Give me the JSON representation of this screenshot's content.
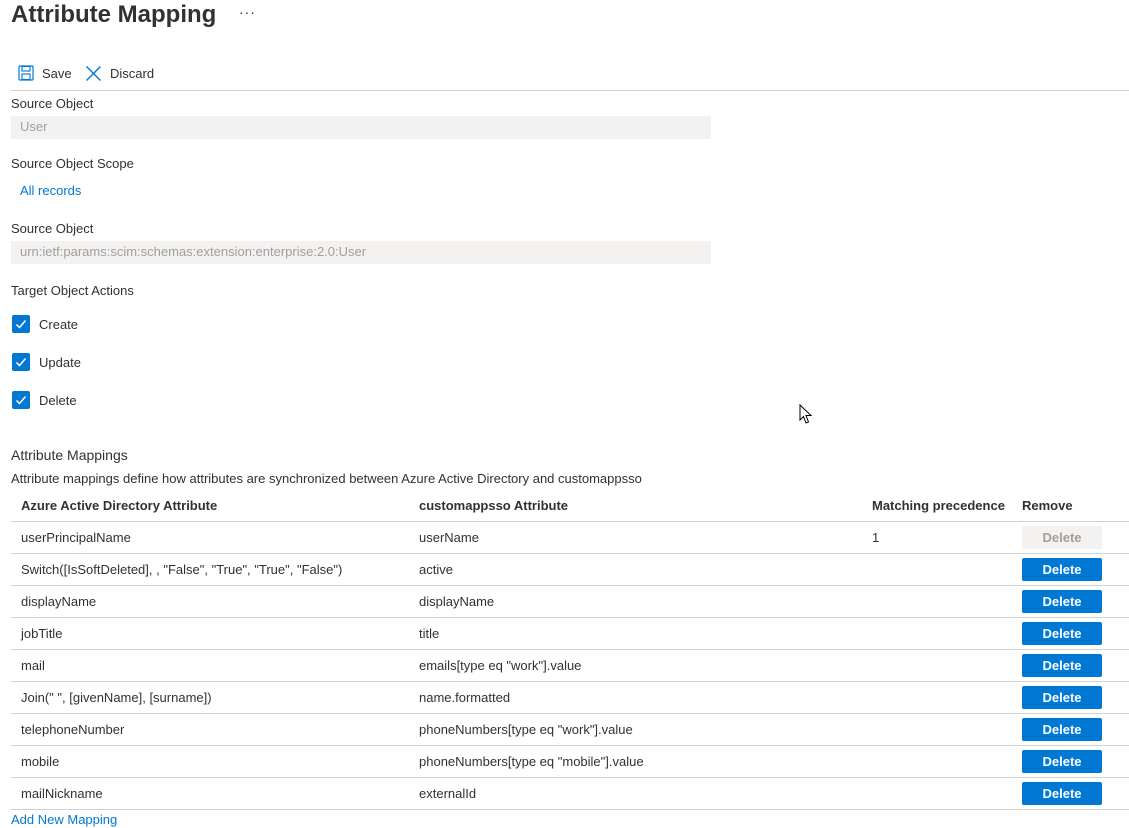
{
  "header": {
    "title": "Attribute Mapping",
    "more_label": "···"
  },
  "toolbar": {
    "save_label": "Save",
    "discard_label": "Discard",
    "save_icon": "save-icon",
    "discard_icon": "close-icon"
  },
  "source_object": {
    "label": "Source Object",
    "value": "User"
  },
  "source_scope": {
    "label": "Source Object Scope",
    "link": "All records"
  },
  "source_object_ext": {
    "label": "Source Object",
    "value": "urn:ietf:params:scim:schemas:extension:enterprise:2.0:User"
  },
  "target_actions": {
    "label": "Target Object Actions",
    "options": [
      {
        "label": "Create",
        "checked": true
      },
      {
        "label": "Update",
        "checked": true
      },
      {
        "label": "Delete",
        "checked": true
      }
    ]
  },
  "mappings": {
    "title": "Attribute Mappings",
    "description": "Attribute mappings define how attributes are synchronized between Azure Active Directory and customappsso",
    "columns": [
      "Azure Active Directory Attribute",
      "customappsso Attribute",
      "Matching precedence",
      "Remove"
    ],
    "rows": [
      {
        "source": "userPrincipalName",
        "target": "userName",
        "precedence": "1",
        "action": "Delete",
        "disabled": true
      },
      {
        "source": "Switch([IsSoftDeleted], , \"False\", \"True\", \"True\", \"False\")",
        "target": "active",
        "precedence": "",
        "action": "Delete",
        "disabled": false
      },
      {
        "source": "displayName",
        "target": "displayName",
        "precedence": "",
        "action": "Delete",
        "disabled": false
      },
      {
        "source": "jobTitle",
        "target": "title",
        "precedence": "",
        "action": "Delete",
        "disabled": false
      },
      {
        "source": "mail",
        "target": "emails[type eq \"work\"].value",
        "precedence": "",
        "action": "Delete",
        "disabled": false
      },
      {
        "source": "Join(\" \", [givenName], [surname])",
        "target": "name.formatted",
        "precedence": "",
        "action": "Delete",
        "disabled": false
      },
      {
        "source": "telephoneNumber",
        "target": "phoneNumbers[type eq \"work\"].value",
        "precedence": "",
        "action": "Delete",
        "disabled": false
      },
      {
        "source": "mobile",
        "target": "phoneNumbers[type eq \"mobile\"].value",
        "precedence": "",
        "action": "Delete",
        "disabled": false
      },
      {
        "source": "mailNickname",
        "target": "externalId",
        "precedence": "",
        "action": "Delete",
        "disabled": false
      }
    ],
    "add_link": "Add New Mapping"
  },
  "colors": {
    "accent": "#0078d4",
    "text": "#323130",
    "disabled_bg": "#f3f2f1",
    "disabled_text": "#a19f9d",
    "border": "#d1d1d1"
  }
}
